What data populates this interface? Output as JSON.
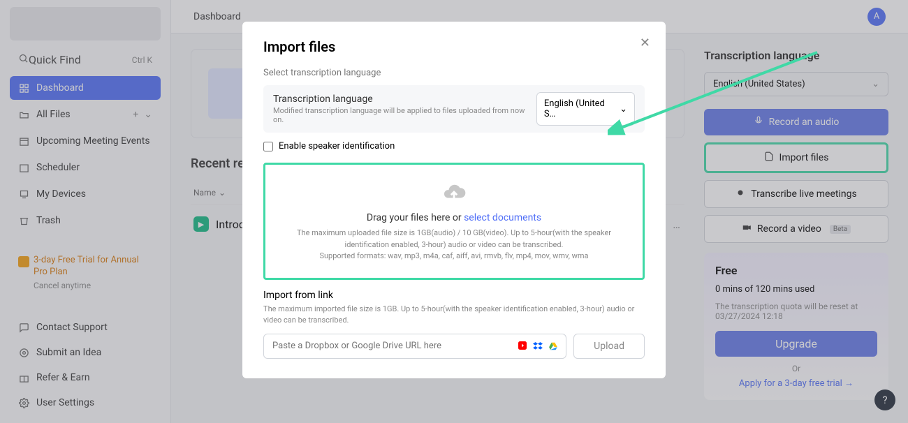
{
  "topbar": {
    "title": "Dashboard",
    "avatar": "A"
  },
  "sidebar": {
    "quickfind": {
      "label": "Quick Find",
      "shortcut": "Ctrl  K"
    },
    "items": [
      {
        "label": "Dashboard"
      },
      {
        "label": "All Files"
      },
      {
        "label": "Upcoming Meeting Events"
      },
      {
        "label": "Scheduler"
      },
      {
        "label": "My Devices"
      },
      {
        "label": "Trash"
      }
    ],
    "trial": {
      "title": "3-day Free Trial for Annual Pro Plan",
      "sub": "Cancel anytime"
    },
    "bottom": [
      {
        "label": "Contact Support"
      },
      {
        "label": "Submit an Idea"
      },
      {
        "label": "Refer & Earn"
      },
      {
        "label": "User Settings"
      }
    ]
  },
  "center": {
    "recent_heading": "Recent re",
    "table_col": "Name",
    "row1": "Introdu"
  },
  "rightcol": {
    "title": "Transcription language",
    "lang": "English (United States)",
    "actions": {
      "record_audio": "Record an audio",
      "import": "Import files",
      "transcribe_live": "Transcribe live meetings",
      "record_video": "Record a video",
      "beta": "Beta"
    },
    "plan": {
      "title": "Free",
      "usage": "0 mins of 120 mins used",
      "reset": "The transcription quota will be reset at 03/27/2024 12:18",
      "upgrade": "Upgrade",
      "or": "Or",
      "trial_link": "Apply for a 3-day free trial  →"
    }
  },
  "modal": {
    "title": "Import files",
    "section_label": "Select transcription language",
    "lang_title": "Transcription language",
    "lang_sub": "Modified transcription language will be applied to files uploaded from now on.",
    "lang_value": "English (United S…",
    "speaker_id": "Enable speaker identification",
    "drop_line1": "Drag your files here or ",
    "drop_link": "select documents",
    "drop_sub1": "The maximum uploaded file size is 1GB(audio) / 10 GB(video). Up to 5-hour(with the speaker identification enabled, 3-hour) audio or video can be transcribed.",
    "drop_sub2": "Supported formats: wav, mp3, m4a, caf, aiff, avi, rmvb, flv, mp4, mov, wmv, wma",
    "import_link_h": "Import from link",
    "import_link_s": "The maximum imported file size is 1GB. Up to 5-hour(with the speaker identification enabled, 3-hour) audio or video can be transcribed.",
    "url_placeholder": "Paste a Dropbox or Google Drive URL here",
    "upload": "Upload"
  }
}
